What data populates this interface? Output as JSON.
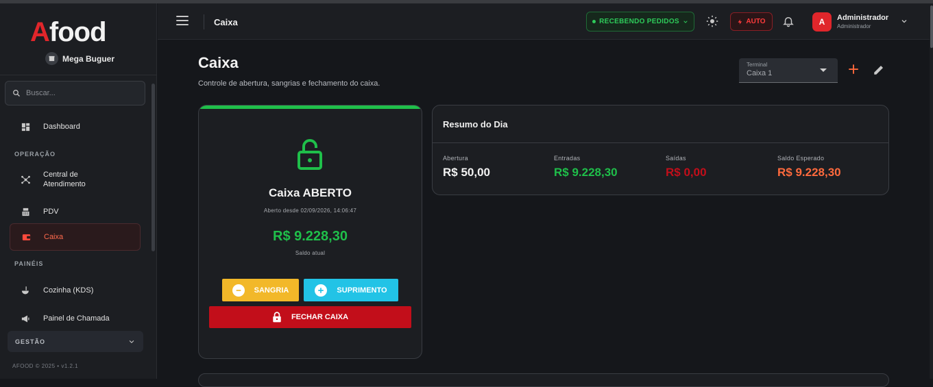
{
  "brand": {
    "logo_a": "A",
    "logo_rest": "food",
    "store_name": "Mega Buguer"
  },
  "search": {
    "placeholder": "Buscar..."
  },
  "sidebar": {
    "items": [
      {
        "label": "Dashboard"
      },
      {
        "label": "Central de Atendimento"
      },
      {
        "label": "PDV"
      },
      {
        "label": "Caixa"
      },
      {
        "label": "Cozinha (KDS)"
      },
      {
        "label": "Painel de Chamada"
      }
    ],
    "sections": {
      "operacao": "OPERAÇÃO",
      "paineis": "PAINÉIS",
      "gestao": "GESTÃO"
    },
    "footer": "AFOOD © 2025 • v1.2.1"
  },
  "topbar": {
    "title": "Caixa",
    "status": "RECEBENDO PEDIDOS",
    "auto": "AUTO",
    "user_initial": "A",
    "user_name": "Administrador",
    "user_role": "Administrador"
  },
  "page": {
    "title": "Caixa",
    "subtitle": "Controle de abertura, sangrias e fechamento do caixa.",
    "terminal_label": "Terminal",
    "terminal_value": "Caixa 1"
  },
  "caixa": {
    "status": "Caixa ABERTO",
    "since": "Aberto desde 02/09/2026, 14:06:47",
    "balance": "R$ 9.228,30",
    "balance_label": "Saldo atual",
    "sangria": "SANGRIA",
    "suprimento": "SUPRIMENTO",
    "fechar": "FECHAR CAIXA"
  },
  "resumo": {
    "title": "Resumo do Dia",
    "stats": [
      {
        "label": "Abertura",
        "value": "R$ 50,00",
        "color": "#f2f2f2"
      },
      {
        "label": "Entradas",
        "value": "R$ 9.228,30",
        "color": "#1fbf4a"
      },
      {
        "label": "Saídas",
        "value": "R$ 0,00",
        "color": "#c20e1a"
      },
      {
        "label": "Saldo Esperado",
        "value": "R$ 9.228,30",
        "color": "#ff6a3d"
      }
    ]
  },
  "colors": {
    "accent": "#e0262b",
    "success": "#1fbf4a",
    "warning": "#f2b829",
    "info": "#22c3e6",
    "danger": "#c20e1a"
  }
}
